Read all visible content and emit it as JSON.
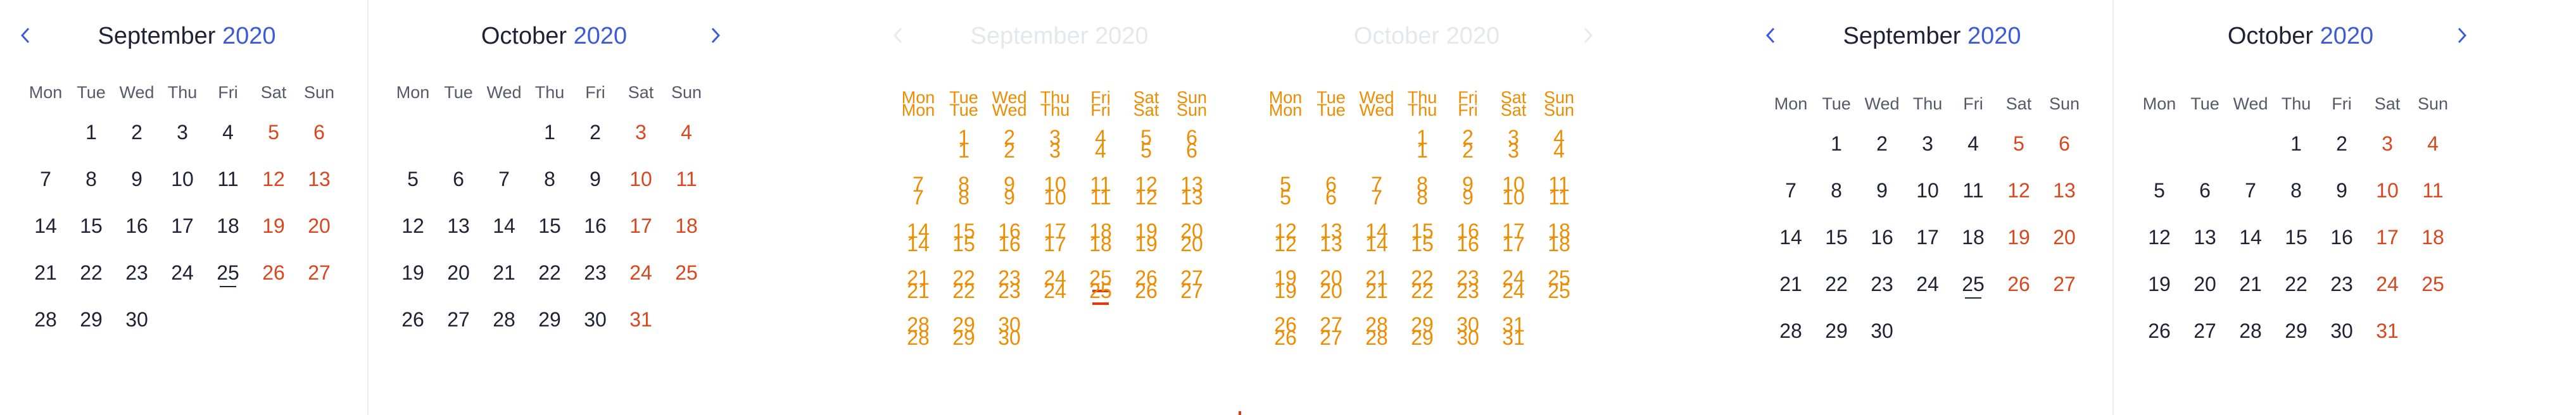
{
  "weekdays": [
    "Mon",
    "Tue",
    "Wed",
    "Thu",
    "Fri",
    "Sat",
    "Sun"
  ],
  "left_panel": {
    "september": {
      "month": "September",
      "year": "2020"
    },
    "october": {
      "month": "October",
      "year": "2020"
    }
  },
  "middle_panel": {
    "september": {
      "month": "September",
      "year": "2020"
    },
    "october": {
      "month": "October",
      "year": "2020"
    }
  },
  "right_panel": {
    "september": {
      "month": "September",
      "year": "2020"
    },
    "october": {
      "month": "October",
      "year": "2020"
    }
  },
  "september_days": [
    [
      "",
      "1",
      "2",
      "3",
      "4",
      "5",
      "6"
    ],
    [
      "7",
      "8",
      "9",
      "10",
      "11",
      "12",
      "13"
    ],
    [
      "14",
      "15",
      "16",
      "17",
      "18",
      "19",
      "20"
    ],
    [
      "21",
      "22",
      "23",
      "24",
      "25",
      "26",
      "27"
    ],
    [
      "28",
      "29",
      "30",
      "",
      "",
      "",
      ""
    ]
  ],
  "october_days": [
    [
      "",
      "",
      "",
      "1",
      "2",
      "3",
      "4"
    ],
    [
      "5",
      "6",
      "7",
      "8",
      "9",
      "10",
      "11"
    ],
    [
      "12",
      "13",
      "14",
      "15",
      "16",
      "17",
      "18"
    ],
    [
      "19",
      "20",
      "21",
      "22",
      "23",
      "24",
      "25"
    ],
    [
      "26",
      "27",
      "28",
      "29",
      "30",
      "31",
      ""
    ]
  ],
  "today": "25",
  "colors": {
    "accent": "#3d5bd6",
    "weekend": "#d8471f",
    "ghost": "#ed8c00"
  },
  "icons": {
    "prev": "chevron-left-icon",
    "next": "chevron-right-icon"
  }
}
